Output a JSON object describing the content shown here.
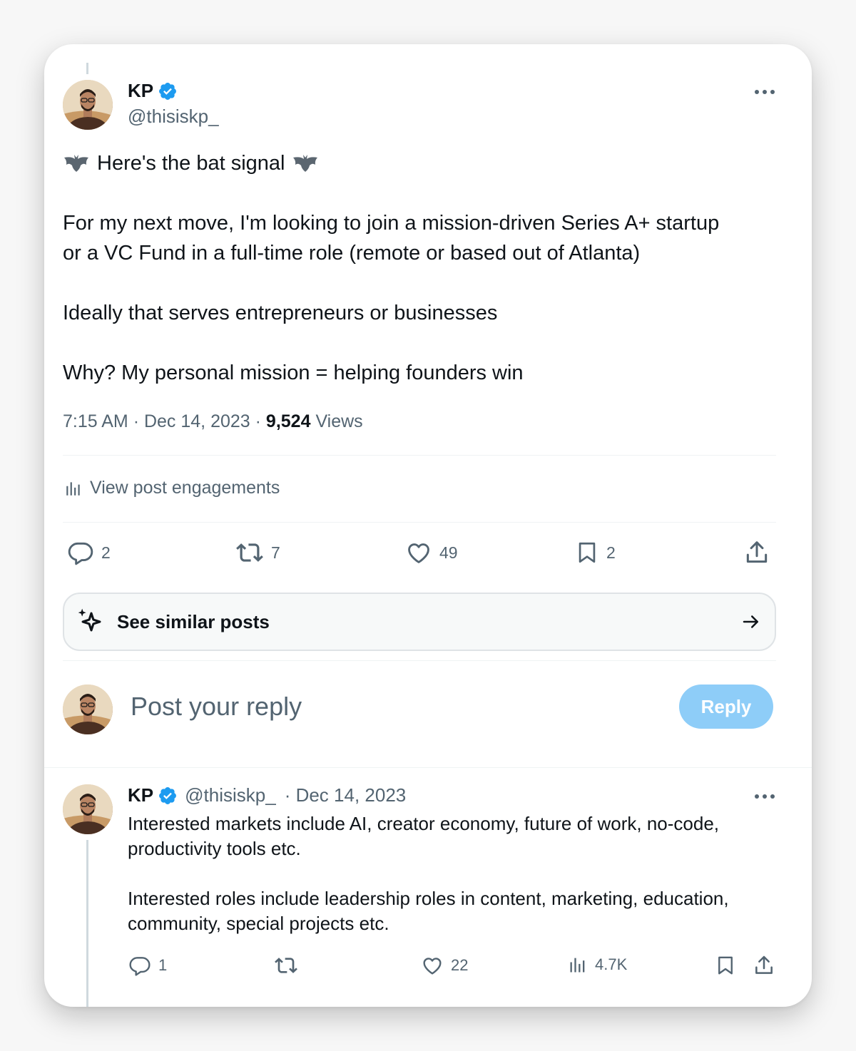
{
  "tweet": {
    "author": {
      "name": "KP",
      "handle": "@thisiskp_"
    },
    "title_line": "Here's the bat signal",
    "body": "For my next move, I'm looking to join a mission-driven Series A+ startup\nor a VC Fund in a full-time role (remote or based out of Atlanta)\n\nIdeally that serves entrepreneurs or businesses\n\nWhy? My personal mission = helping founders win",
    "time": "7:15 AM",
    "date": "Dec 14, 2023",
    "views_count": "9,524",
    "views_label": "Views",
    "separator": "·"
  },
  "engagements_label": "View post engagements",
  "actions": {
    "replies": "2",
    "reposts": "7",
    "likes": "49",
    "bookmarks": "2"
  },
  "similar": {
    "label": "See similar posts"
  },
  "composer": {
    "placeholder": "Post your reply",
    "button_label": "Reply"
  },
  "reply_tweet": {
    "name": "KP",
    "handle": "@thisiskp_",
    "date": "· Dec 14, 2023",
    "body": "Interested markets include AI, creator economy, future of work, no-code,\nproductivity tools etc.\n\nInterested roles include leadership roles in content, marketing, education,\ncommunity, special projects etc.",
    "replies": "1",
    "likes": "22",
    "views": "4.7K"
  },
  "colors": {
    "accent": "#1d9bf0",
    "reply_button_disabled": "#8ecdf8",
    "secondary_text": "#536471",
    "divider": "#eff3f4"
  },
  "icons": [
    "verified-badge-icon",
    "more-icon",
    "bat-icon",
    "bar-chart-icon",
    "reply-icon",
    "repost-icon",
    "like-icon",
    "bookmark-icon",
    "share-icon",
    "sparkle-icon",
    "arrow-right-icon"
  ]
}
